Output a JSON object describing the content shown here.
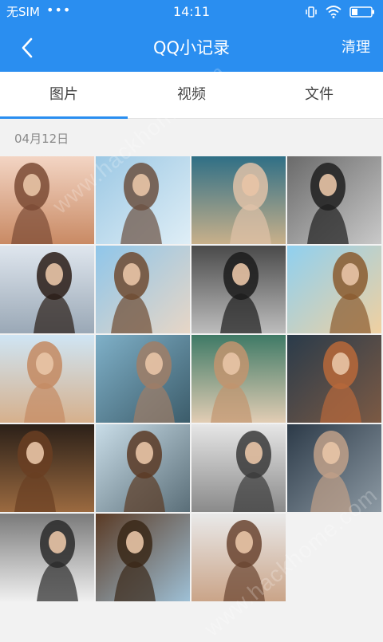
{
  "status_bar": {
    "carrier": "无SIM",
    "dots": "•••",
    "time": "14:11",
    "icons": [
      "vibrate-icon",
      "wifi-icon",
      "battery-icon"
    ]
  },
  "nav": {
    "title": "QQ小记录",
    "back_icon": "chevron-left-icon",
    "clean_label": "清理"
  },
  "tabs": [
    {
      "label": "图片",
      "active": true
    },
    {
      "label": "视频",
      "active": false
    },
    {
      "label": "文件",
      "active": false
    }
  ],
  "date_group": "04月12日",
  "photos": [
    {
      "name": "photo-1",
      "bg": [
        "#f3d5c4",
        "#c98a64"
      ],
      "fig": "#7a4a34"
    },
    {
      "name": "photo-2",
      "bg": [
        "#9cc8e4",
        "#dfeef6"
      ],
      "fig": "#6b5040"
    },
    {
      "name": "photo-3",
      "bg": [
        "#2f6f86",
        "#c8b08a"
      ],
      "fig": "#e0c2a8"
    },
    {
      "name": "photo-4",
      "bg": [
        "#6a6a6a",
        "#c9c9c9"
      ],
      "fig": "#1e1e1e"
    },
    {
      "name": "photo-5",
      "bg": [
        "#dfe6ee",
        "#9aa8b6"
      ],
      "fig": "#2a1c16"
    },
    {
      "name": "photo-6",
      "bg": [
        "#8fc6ea",
        "#e7d6c6"
      ],
      "fig": "#6e4a30"
    },
    {
      "name": "photo-7",
      "bg": [
        "#4a4a4a",
        "#bdbdbd"
      ],
      "fig": "#1b1b1b"
    },
    {
      "name": "photo-8",
      "bg": [
        "#8fd0f0",
        "#f0d0a0"
      ],
      "fig": "#8a5a2e"
    },
    {
      "name": "photo-9",
      "bg": [
        "#cfe5f4",
        "#d6b08c"
      ],
      "fig": "#c48a62"
    },
    {
      "name": "photo-10",
      "bg": [
        "#7fb0c8",
        "#3c5c6a"
      ],
      "fig": "#a07e66"
    },
    {
      "name": "photo-11",
      "bg": [
        "#3f7a66",
        "#e2cdb4"
      ],
      "fig": "#c2946e"
    },
    {
      "name": "photo-12",
      "bg": [
        "#2a3b4a",
        "#7c5a44"
      ],
      "fig": "#b8683a"
    },
    {
      "name": "photo-13",
      "bg": [
        "#2b2018",
        "#9b6a40"
      ],
      "fig": "#6a3e22"
    },
    {
      "name": "photo-14",
      "bg": [
        "#c9dde8",
        "#5a6e78"
      ],
      "fig": "#5b3a24"
    },
    {
      "name": "photo-15",
      "bg": [
        "#e6e6e6",
        "#8a8a8a"
      ],
      "fig": "#3a3a3a"
    },
    {
      "name": "photo-16",
      "bg": [
        "#2c3a48",
        "#8d9aa4"
      ],
      "fig": "#c0a088"
    },
    {
      "name": "photo-17",
      "bg": [
        "#7a7a7a",
        "#f0f0f0"
      ],
      "fig": "#2a2a2a"
    },
    {
      "name": "photo-18",
      "bg": [
        "#5a3a24",
        "#9ec0d6"
      ],
      "fig": "#3a2818"
    },
    {
      "name": "photo-19",
      "bg": [
        "#e9e9e9",
        "#caa488"
      ],
      "fig": "#6a4430"
    }
  ],
  "watermark": "www.hackhome.com"
}
